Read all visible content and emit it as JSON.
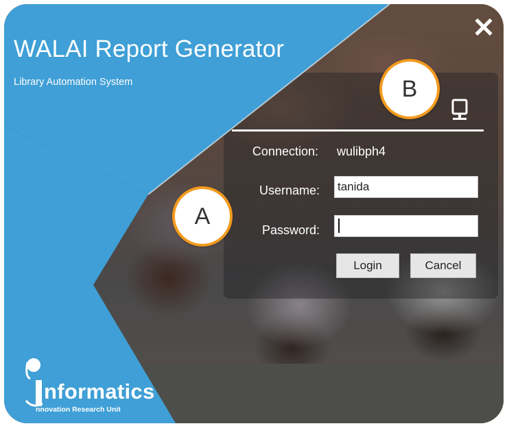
{
  "app": {
    "title": "WALAI Report Generator",
    "subtitle": "Library Automation System",
    "close_icon": "close-icon",
    "server_icon": "server-icon"
  },
  "callouts": {
    "a": "A",
    "b": "B"
  },
  "login": {
    "connection_label": "Connection:",
    "connection_value": "wulibph4",
    "username_label": "Username:",
    "username_value": "tanida",
    "password_label": "Password:",
    "password_value": "",
    "login_button": "Login",
    "cancel_button": "Cancel"
  },
  "branding": {
    "logo_text": "nformatics",
    "logo_subtext": "nnovation Research Unit"
  },
  "colors": {
    "brand_blue": "#3f9fd6",
    "callout_orange": "#f39a1e"
  }
}
